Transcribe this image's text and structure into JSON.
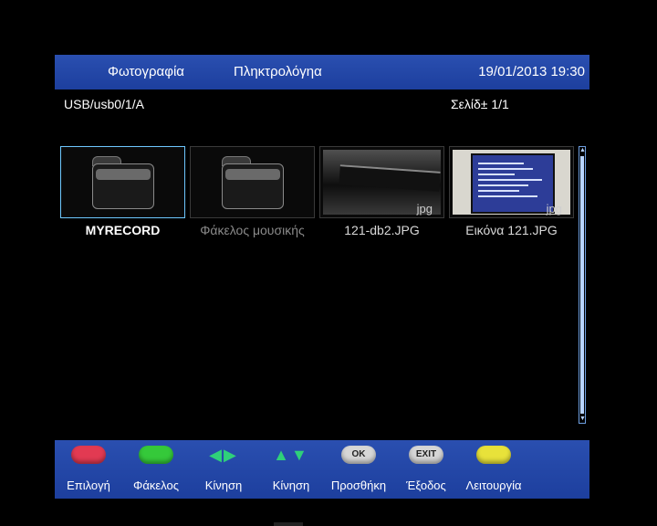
{
  "header": {
    "tab_photo": "Φωτογραφία",
    "tab_keyboard": "Πληκτρολόγηα",
    "datetime": "19/01/2013 19:30"
  },
  "path": "USB/usb0/1/A",
  "page_indicator": "Σελίδ± 1/1",
  "items": [
    {
      "label": "MYRECORD",
      "type": "folder",
      "state": "selected"
    },
    {
      "label": "Φάκελος μουσικής",
      "type": "folder",
      "state": "dim"
    },
    {
      "label": "121-db2.JPG",
      "type": "image",
      "ext": "jpg"
    },
    {
      "label": "Εικόνα 121.JPG",
      "type": "image",
      "ext": "jpg"
    }
  ],
  "footer": [
    {
      "icon": "red-button-icon",
      "color": "#e23a52",
      "label": "Επιλογή"
    },
    {
      "icon": "green-button-icon",
      "color": "#35c93a",
      "label": "Φάκελος"
    },
    {
      "icon": "left-right-arrows-icon",
      "label": "Κίνηση"
    },
    {
      "icon": "up-down-arrows-icon",
      "label": "Κίνηση"
    },
    {
      "icon": "ok-button-icon",
      "key_text": "OK",
      "label": "Προσθήκη"
    },
    {
      "icon": "exit-button-icon",
      "key_text": "EXIT",
      "label": "Έξοδος"
    },
    {
      "icon": "yellow-button-icon",
      "color": "#e8e23a",
      "label": "Λειτουργία"
    }
  ],
  "colors": {
    "header_bg": "#1d3f9e",
    "selection_border": "#6ec8ff",
    "arrow_green": "#2fd07a"
  }
}
